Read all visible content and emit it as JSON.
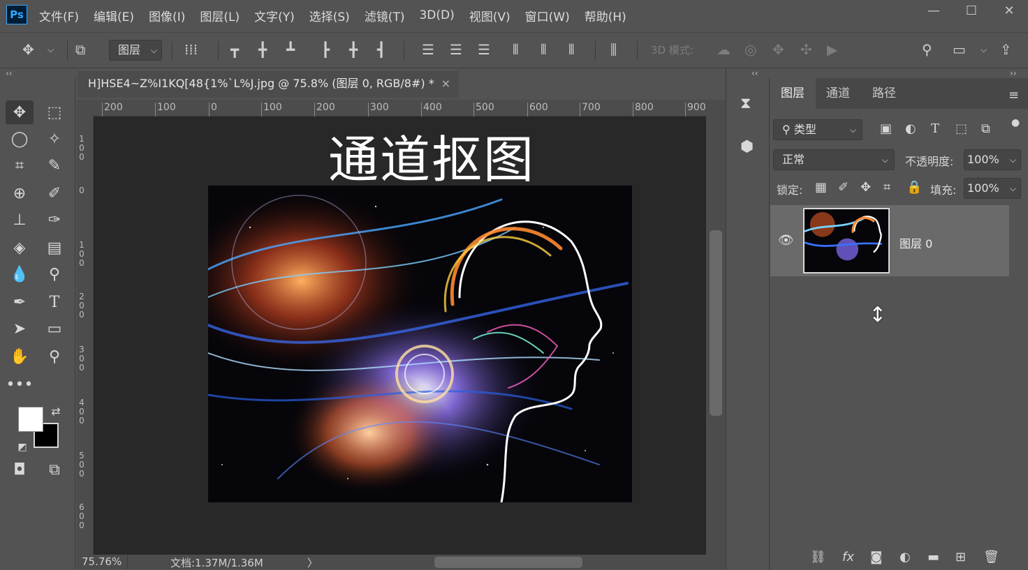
{
  "app": {
    "logo": "Ps"
  },
  "menu": [
    "文件(F)",
    "编辑(E)",
    "图像(I)",
    "图层(L)",
    "文字(Y)",
    "选择(S)",
    "滤镜(T)",
    "3D(D)",
    "视图(V)",
    "窗口(W)",
    "帮助(H)"
  ],
  "window_controls": {
    "minimize": "—",
    "maximize": "☐",
    "close": "✕"
  },
  "options": {
    "auto_select": "图层",
    "mode_3d": "3D 模式:"
  },
  "document": {
    "tab_title": "H]HSE4~Z%I1KQ[48{1%`L%J.jpg @ 75.8% (图层 0, RGB/8#) *",
    "close": "×",
    "ruler_top": [
      "200",
      "100",
      "0",
      "100",
      "200",
      "300",
      "400",
      "500",
      "600",
      "700",
      "800",
      "900"
    ],
    "ruler_left": [
      "100",
      "0",
      "100",
      "200",
      "300",
      "400",
      "500",
      "600"
    ],
    "canvas_text": "通道抠图"
  },
  "status": {
    "zoom": "75.76%",
    "doc": "文档:1.37M/1.36M",
    "arrow": "〉"
  },
  "panel": {
    "collapse_left": "‹‹",
    "collapse_right": "››",
    "tabs": [
      "图层",
      "通道",
      "路径"
    ],
    "filter_kind": "类型",
    "blend_mode": "正常",
    "opacity_label": "不透明度:",
    "opacity_value": "100%",
    "lock_label": "锁定:",
    "fill_label": "填充:",
    "fill_value": "100%",
    "layer_name": "图层 0",
    "footer": [
      "⛓",
      "fx",
      "◙",
      "◐",
      "▬",
      "⊞",
      "🗑"
    ]
  },
  "colors": {
    "accent": "#31a8ff",
    "bg": "#535353",
    "canvas": "#282828"
  }
}
